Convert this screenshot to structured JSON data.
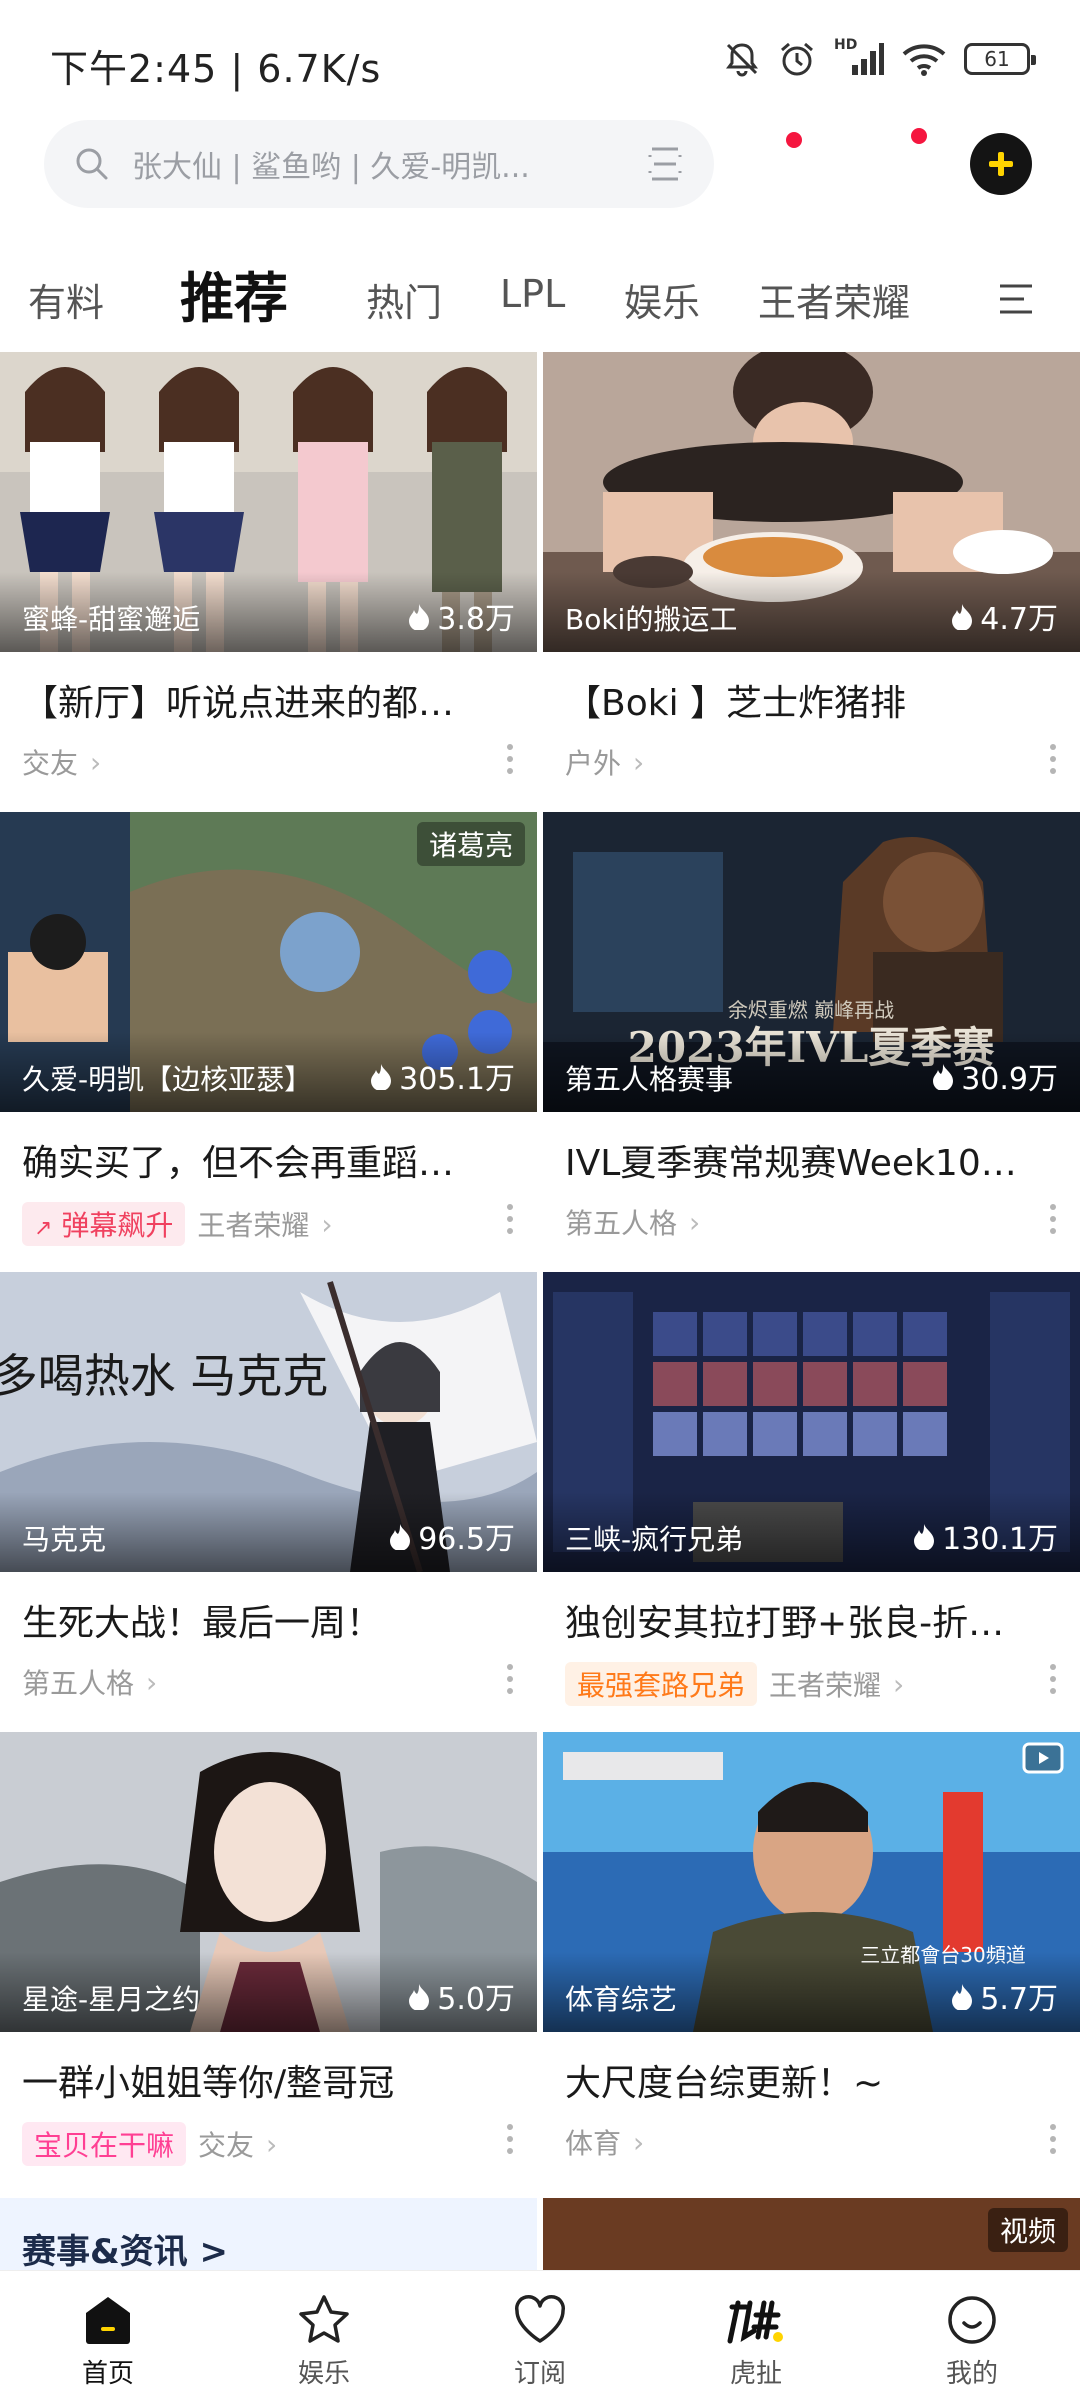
{
  "status": {
    "time": "下午2:45 | 6.7K/s",
    "network_label": "HD",
    "battery": "61"
  },
  "search": {
    "placeholder": "张大仙 | 鲨鱼哟 | 久爱-明凯..."
  },
  "tabs": [
    {
      "label": "有料",
      "active": false
    },
    {
      "label": "推荐",
      "active": true
    },
    {
      "label": "热门",
      "active": false
    },
    {
      "label": "LPL",
      "active": false
    },
    {
      "label": "娱乐",
      "active": false
    },
    {
      "label": "王者荣耀",
      "active": false
    }
  ],
  "cards": [
    {
      "streamer": "蜜蜂-甜蜜邂逅",
      "hot": "3.8万",
      "title": "【新厅】听说点进来的都…",
      "category": "交友",
      "badge": "",
      "corner_tag": ""
    },
    {
      "streamer": "Boki的搬运工",
      "hot": "4.7万",
      "title": "【Boki 】芝士炸猪排",
      "category": "户外",
      "badge": "",
      "corner_tag": ""
    },
    {
      "streamer": "久爱-明凯【边核亚瑟】",
      "hot": "305.1万",
      "title": "确实买了，但不会再重蹈…",
      "category": "王者荣耀",
      "badge": "弹幕飙升",
      "corner_tag": "诸葛亮"
    },
    {
      "streamer": "第五人格赛事",
      "hot": "30.9万",
      "title": "IVL夏季赛常规赛Week10…",
      "category": "第五人格",
      "badge": "",
      "corner_tag": "",
      "thumb_text": "2023年IVL夏季赛",
      "thumb_sub": "余烬重燃 巅峰再战"
    },
    {
      "streamer": "马克克",
      "hot": "96.5万",
      "title": "生死大战！最后一周！",
      "category": "第五人格",
      "badge": "",
      "corner_tag": "",
      "thumb_text": "多喝热水 马克克"
    },
    {
      "streamer": "三峡-疯行兄弟",
      "hot": "130.1万",
      "title": "独创安其拉打野+张良-折…",
      "category": "王者荣耀",
      "badge": "最强套路兄弟",
      "corner_tag": ""
    },
    {
      "streamer": "星途-星月之约",
      "hot": "5.0万",
      "title": "一群小姐姐等你/整哥冠",
      "category": "交友",
      "badge": "宝贝在干嘛",
      "corner_tag": ""
    },
    {
      "streamer": "体育综艺",
      "hot": "5.7万",
      "title": "大尺度台综更新！~",
      "category": "体育",
      "badge": "",
      "corner_tag": "",
      "thumb_sub": "三立都會台30頻道"
    }
  ],
  "peek": {
    "left_title": "赛事&资讯 >",
    "right_tag": "视频"
  },
  "bottom_nav": [
    {
      "label": "首页",
      "icon": "home-icon",
      "active": true
    },
    {
      "label": "娱乐",
      "icon": "star-icon",
      "active": false
    },
    {
      "label": "订阅",
      "icon": "heart-icon",
      "active": false
    },
    {
      "label": "虎扯",
      "icon": "huche-icon",
      "active": false
    },
    {
      "label": "我的",
      "icon": "profile-icon",
      "active": false
    }
  ],
  "colors": {
    "accent_yellow": "#ffd400",
    "notification_red": "#f5163f",
    "badge_pink": "#f0415f",
    "badge_orange": "#ff7a1a",
    "badge_rose": "#ff3f93"
  }
}
